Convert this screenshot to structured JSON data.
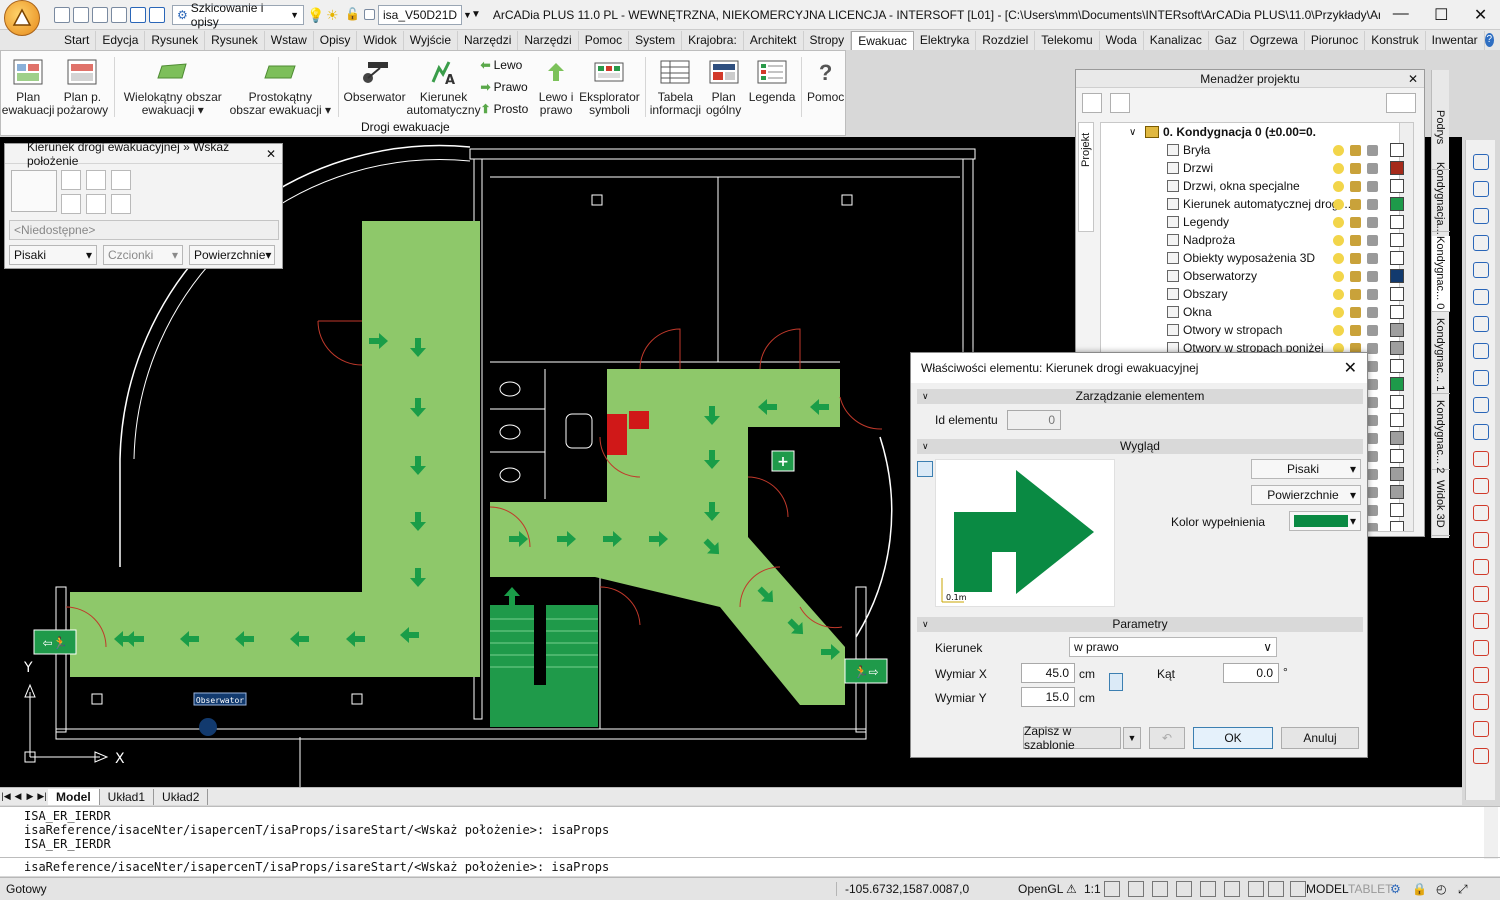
{
  "titlebar": {
    "style_combo": "Szkicowanie i opisy",
    "layer_combo": "isa_V50D21D",
    "title": "ArCADia PLUS 11.0 PL - WEWNĘTRZNA, NIEKOMERCYJNA LICENCJA - INTERSOFT [L01] - [C:\\Users\\mm\\Documents\\INTERsoft\\ArCADia PLUS\\11.0\\Przykłady\\ArC...",
    "minimize": "—",
    "maximize": "☐",
    "close": "✕"
  },
  "tabs": [
    "Start",
    "Edycja",
    "Rysunek",
    "Rysunek",
    "Wstaw",
    "Opisy",
    "Widok",
    "Wyjście",
    "Narzędzi",
    "Narzędzi",
    "Pomoc",
    "System",
    "Krajobra:",
    "Architekt",
    "Stropy",
    "Ewakuac",
    "Elektryka",
    "Rozdziel",
    "Telekomu",
    "Woda",
    "Kanalizac",
    "Gaz",
    "Ogrzewa",
    "Piorunoc",
    "Konstruk",
    "Inwentar"
  ],
  "active_tab_index": 15,
  "ribbon": {
    "plan_evac": [
      "Plan",
      "ewakuacji"
    ],
    "plan_fire": [
      "Plan p.",
      "pożarowy"
    ],
    "poly_area": [
      "Wielokątny obszar",
      "ewakuacji ▾"
    ],
    "rect_area": [
      "Prostokątny",
      "obszar ewakuacji ▾"
    ],
    "observer": "Obserwator",
    "direction_auto": [
      "Kierunek",
      "automatyczny"
    ],
    "left": "Lewo",
    "right": "Prawo",
    "straight": "Prosto",
    "left_right": [
      "Lewo i",
      "prawo"
    ],
    "symbol_explorer": [
      "Eksplorator",
      "symboli"
    ],
    "info_table": [
      "Tabela",
      "informacji"
    ],
    "plan_general": [
      "Plan",
      "ogólny"
    ],
    "legend": "Legenda",
    "help": "Pomoc",
    "group_label": "Drogi ewakuacje"
  },
  "cmdpanel": {
    "title": "Kierunek drogi ewakuacyjnej » Wskaż położenie",
    "unavailable": "<Niedostępne>",
    "pens": "Pisaki",
    "fonts": "Czcionki",
    "surfaces": "Powierzchnie"
  },
  "project_manager": {
    "title": "Menadżer projektu",
    "side_tab": "Projekt",
    "root": "0. Kondygnacja 0 (±0.00=0.",
    "items": [
      {
        "label": "Bryła",
        "color": "#ffffff"
      },
      {
        "label": "Drzwi",
        "color": "#a52a1a"
      },
      {
        "label": "Drzwi, okna specjalne",
        "color": "#ffffff"
      },
      {
        "label": "Kierunek automatycznej drogi ...",
        "color": "#1e9a4a"
      },
      {
        "label": "Legendy",
        "color": "#ffffff"
      },
      {
        "label": "Nadproża",
        "color": "#ffffff"
      },
      {
        "label": "Obiekty wyposażenia 3D",
        "color": "#ffffff"
      },
      {
        "label": "Obserwatorzy",
        "color": "#123a6e"
      },
      {
        "label": "Obszary",
        "color": "#ffffff"
      },
      {
        "label": "Okna",
        "color": "#ffffff"
      },
      {
        "label": "Otwory w stropach",
        "color": "#9e9e9e"
      },
      {
        "label": "Otwory w stropach poniżej",
        "color": "#9e9e9e"
      },
      {
        "label": "",
        "color": "#ffffff"
      },
      {
        "label": "",
        "color": "#1e9a4a"
      },
      {
        "label": "",
        "color": "#ffffff"
      },
      {
        "label": "",
        "color": "#ffffff"
      },
      {
        "label": "",
        "color": "#9e9e9e"
      },
      {
        "label": "",
        "color": "#ffffff"
      },
      {
        "label": "",
        "color": "#9e9e9e"
      },
      {
        "label": "",
        "color": "#9e9e9e"
      },
      {
        "label": "",
        "color": "#ffffff"
      },
      {
        "label": "",
        "color": "#ffffff"
      }
    ]
  },
  "right_vtabs": [
    "Podrys",
    "Kondygnacja...",
    "Kondygnac... 0",
    "Kondygnac... 1",
    "Kondygnac... 2",
    "Widok 3D"
  ],
  "dialog": {
    "title": "Właściwości elementu: Kierunek drogi ewakuacyjnej",
    "sect_manage": "Zarządzanie elementem",
    "id_label": "Id elementu",
    "id_value": "0",
    "sect_look": "Wygląd",
    "pens": "Pisaki",
    "surfaces": "Powierzchnie",
    "fill_color_label": "Kolor wypełnienia",
    "fill_color": "#0a8a43",
    "scale_label": "0.1m",
    "sect_params": "Parametry",
    "direction_label": "Kierunek",
    "direction_value": "w prawo",
    "dim_x_label": "Wymiar X",
    "dim_x_value": "45.0",
    "dim_y_label": "Wymiar Y",
    "dim_y_value": "15.0",
    "unit": "cm",
    "angle_label": "Kąt",
    "angle_value": "0.0",
    "angle_unit": "°",
    "save_template": "Zapisz w szablonie",
    "ok": "OK",
    "cancel": "Anuluj"
  },
  "canvas": {
    "observer_label": "Obserwator",
    "axis_x": "X",
    "axis_y": "Y"
  },
  "layout_tabs": [
    "Model",
    "Układ1",
    "Układ2"
  ],
  "console": {
    "lines": [
      "ISA_ER_IERDR",
      "isaReference/isaceNter/isapercenT/isaProps/isareStart/<Wskaż położenie>: isaProps",
      "ISA_ER_IERDR"
    ],
    "input": "isaReference/isaceNter/isapercenT/isaProps/isareStart/<Wskaż położenie>: isaProps"
  },
  "status": {
    "ready": "Gotowy",
    "coords": "-105.6732,1587.0087,0",
    "renderer": "OpenGL",
    "scale": "1:1",
    "model": "MODEL",
    "tablet": "TABLET"
  }
}
